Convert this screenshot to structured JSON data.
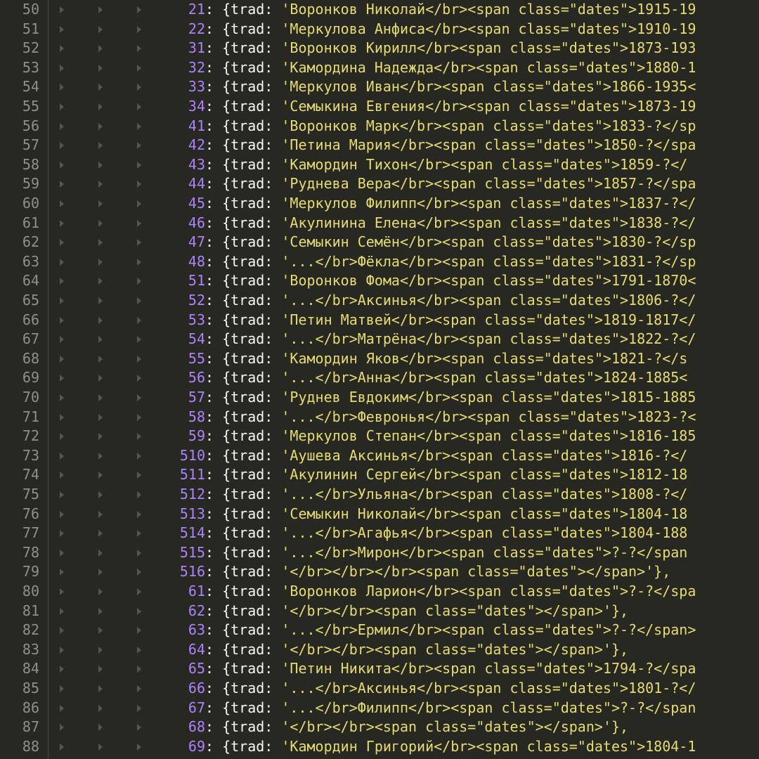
{
  "colors": {
    "background": "#272822",
    "gutter_text": "#8f908a",
    "number": "#ae81ff",
    "string": "#e6db74",
    "punctuation": "#f8f8f2"
  },
  "fold_marker_icon": "fold-arrow-icon",
  "lines": [
    {
      "ln": "50",
      "key": "21",
      "code": "'Воронков Николай</br><span class=\"dates\">1915-19"
    },
    {
      "ln": "51",
      "key": "22",
      "code": "'Меркулова Анфиса</br><span class=\"dates\">1910-19"
    },
    {
      "ln": "52",
      "key": "31",
      "code": "'Воронков Кирилл</br><span class=\"dates\">1873-193"
    },
    {
      "ln": "53",
      "key": "32",
      "code": "'Камордина Надежда</br><span class=\"dates\">1880-1"
    },
    {
      "ln": "54",
      "key": "33",
      "code": "'Меркулов Иван</br><span class=\"dates\">1866-1935<"
    },
    {
      "ln": "55",
      "key": "34",
      "code": "'Семыкина Евгения</br><span class=\"dates\">1873-19"
    },
    {
      "ln": "56",
      "key": "41",
      "code": "'Воронков Марк</br><span class=\"dates\">1833-?</sp"
    },
    {
      "ln": "57",
      "key": "42",
      "code": "'Петина Мария</br><span class=\"dates\">1850-?</spa"
    },
    {
      "ln": "58",
      "key": "43",
      "code": "'Камордин Тихон</br><span class=\"dates\">1859-?</"
    },
    {
      "ln": "59",
      "key": "44",
      "code": "'Руднева Вера</br><span class=\"dates\">1857-?</spa"
    },
    {
      "ln": "60",
      "key": "45",
      "code": "'Меркулов Филипп</br><span class=\"dates\">1837-?</"
    },
    {
      "ln": "61",
      "key": "46",
      "code": "'Акулинина Елена</br><span class=\"dates\">1838-?</"
    },
    {
      "ln": "62",
      "key": "47",
      "code": "'Семыкин Семён</br><span class=\"dates\">1830-?</sp"
    },
    {
      "ln": "63",
      "key": "48",
      "code": "'...</br>Фёкла</br><span class=\"dates\">1831-?</sp"
    },
    {
      "ln": "64",
      "key": "51",
      "code": "'Воронков Фома</br><span class=\"dates\">1791-1870<"
    },
    {
      "ln": "65",
      "key": "52",
      "code": "'...</br>Аксинья</br><span class=\"dates\">1806-?</"
    },
    {
      "ln": "66",
      "key": "53",
      "code": "'Петин Матвей</br><span class=\"dates\">1819-1817</"
    },
    {
      "ln": "67",
      "key": "54",
      "code": "'...</br>Матрёна</br><span class=\"dates\">1822-?</"
    },
    {
      "ln": "68",
      "key": "55",
      "code": "'Камордин Яков</br><span class=\"dates\">1821-?</s"
    },
    {
      "ln": "69",
      "key": "56",
      "code": "'...</br>Анна</br><span class=\"dates\">1824-1885<"
    },
    {
      "ln": "70",
      "key": "57",
      "code": "'Руднев Евдоким</br><span class=\"dates\">1815-1885"
    },
    {
      "ln": "71",
      "key": "58",
      "code": "'...</br>Февронья</br><span class=\"dates\">1823-?<"
    },
    {
      "ln": "72",
      "key": "59",
      "code": "'Меркулов Степан</br><span class=\"dates\">1816-185"
    },
    {
      "ln": "73",
      "key": "510",
      "code": "'Аушева Аксинья</br><span class=\"dates\">1816-?</"
    },
    {
      "ln": "74",
      "key": "511",
      "code": "'Акулинин Сергей</br><span class=\"dates\">1812-18"
    },
    {
      "ln": "75",
      "key": "512",
      "code": "'...</br>Ульяна</br><span class=\"dates\">1808-?</"
    },
    {
      "ln": "76",
      "key": "513",
      "code": "'Семыкин Николай</br><span class=\"dates\">1804-18"
    },
    {
      "ln": "77",
      "key": "514",
      "code": "'...</br>Агафья</br><span class=\"dates\">1804-188"
    },
    {
      "ln": "78",
      "key": "515",
      "code": "'...</br>Мирон</br><span class=\"dates\">?-?</span"
    },
    {
      "ln": "79",
      "key": "516",
      "code": "'</br></br></br><span class=\"dates\"></span>'},"
    },
    {
      "ln": "80",
      "key": "61",
      "code": "'Воронков Ларион</br><span class=\"dates\">?-?</spa"
    },
    {
      "ln": "81",
      "key": "62",
      "code": "'</br></br><span class=\"dates\"></span>'},"
    },
    {
      "ln": "82",
      "key": "63",
      "code": "'...</br>Ермил</br><span class=\"dates\">?-?</span>"
    },
    {
      "ln": "83",
      "key": "64",
      "code": "'</br></br><span class=\"dates\"></span>'},"
    },
    {
      "ln": "84",
      "key": "65",
      "code": "'Петин Никита</br><span class=\"dates\">1794-?</spa"
    },
    {
      "ln": "85",
      "key": "66",
      "code": "'...</br>Аксинья</br><span class=\"dates\">1801-?</"
    },
    {
      "ln": "86",
      "key": "67",
      "code": "'...</br>Филипп</br><span class=\"dates\">?-?</span"
    },
    {
      "ln": "87",
      "key": "68",
      "code": "'</br></br><span class=\"dates\"></span>'},"
    },
    {
      "ln": "88",
      "key": "69",
      "code": "'Камордин Григорий</br><span class=\"dates\">1804-1"
    }
  ]
}
